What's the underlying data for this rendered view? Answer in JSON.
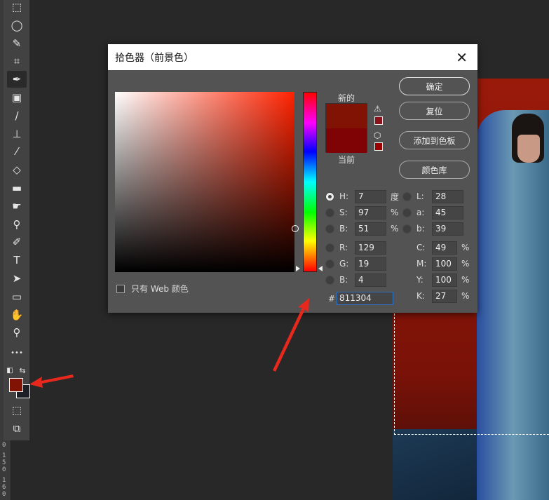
{
  "ruler": {
    "labels": [
      "0",
      "150",
      "160"
    ]
  },
  "toolbar": {
    "tools": [
      {
        "name": "rectangular-marquee",
        "glyph": "⬚"
      },
      {
        "name": "lasso",
        "glyph": "◯"
      },
      {
        "name": "quick-selection",
        "glyph": "✎"
      },
      {
        "name": "crop",
        "glyph": "⌗"
      },
      {
        "name": "eyedropper",
        "glyph": "✒"
      },
      {
        "name": "patch",
        "glyph": "▣"
      },
      {
        "name": "brush",
        "glyph": "/"
      },
      {
        "name": "clone-stamp",
        "glyph": "⊥"
      },
      {
        "name": "history-brush",
        "glyph": "⁄"
      },
      {
        "name": "eraser",
        "glyph": "◇"
      },
      {
        "name": "gradient",
        "glyph": "▬"
      },
      {
        "name": "smudge",
        "glyph": "☛"
      },
      {
        "name": "dodge",
        "glyph": "⚲"
      },
      {
        "name": "pen",
        "glyph": "✐"
      },
      {
        "name": "type",
        "glyph": "T"
      },
      {
        "name": "path-selection",
        "glyph": "➤"
      },
      {
        "name": "rectangle",
        "glyph": "▭"
      },
      {
        "name": "hand",
        "glyph": "✋"
      },
      {
        "name": "zoom",
        "glyph": "⚲"
      },
      {
        "name": "more",
        "glyph": "•••"
      }
    ],
    "foreground_color": "#811304",
    "background_color": "#1d1f26"
  },
  "dialog": {
    "title": "拾色器（前景色）",
    "close": "✕",
    "new_label": "新的",
    "current_label": "当前",
    "new_color": "#811304",
    "current_color": "#7f0305",
    "buttons": {
      "ok": "确定",
      "reset": "复位",
      "add_to_swatches": "添加到色板",
      "color_libraries": "颜色库"
    },
    "web_only_label": "只有 Web 颜色",
    "hsb": [
      {
        "key": "H:",
        "value": "7",
        "unit": "度",
        "selected": true
      },
      {
        "key": "S:",
        "value": "97",
        "unit": "%",
        "selected": false
      },
      {
        "key": "B:",
        "value": "51",
        "unit": "%",
        "selected": false
      }
    ],
    "rgb": [
      {
        "key": "R:",
        "value": "129"
      },
      {
        "key": "G:",
        "value": "19"
      },
      {
        "key": "B:",
        "value": "4"
      }
    ],
    "lab": [
      {
        "key": "L:",
        "value": "28"
      },
      {
        "key": "a:",
        "value": "45"
      },
      {
        "key": "b:",
        "value": "39"
      }
    ],
    "cmyk": [
      {
        "key": "C:",
        "value": "49",
        "unit": "%"
      },
      {
        "key": "M:",
        "value": "100",
        "unit": "%"
      },
      {
        "key": "Y:",
        "value": "100",
        "unit": "%"
      },
      {
        "key": "K:",
        "value": "27",
        "unit": "%"
      }
    ],
    "hex_label": "#",
    "hex": "811304"
  },
  "annotation_color": "#e8281c"
}
